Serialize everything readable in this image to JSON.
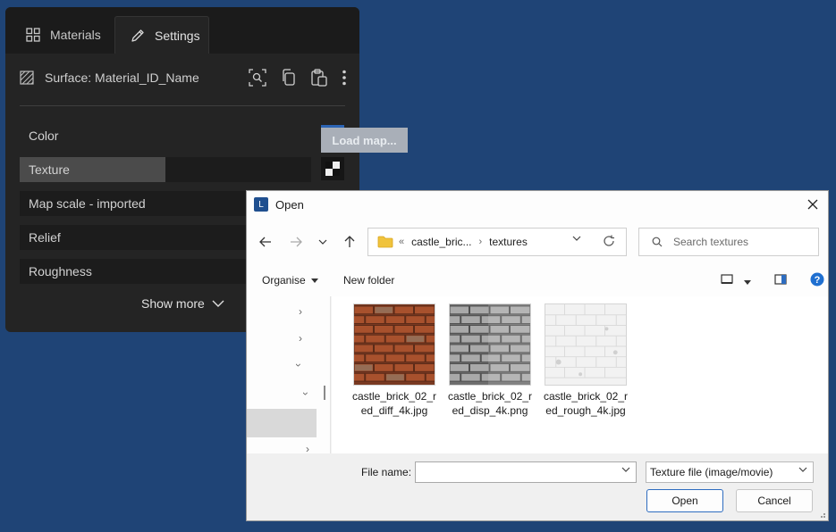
{
  "panel": {
    "tabs": [
      {
        "label": "Materials",
        "icon": "grid-icon"
      },
      {
        "label": "Settings",
        "icon": "pencil-icon"
      }
    ],
    "surface_label": "Surface: Material_ID_Name",
    "properties": [
      {
        "label": "Color"
      },
      {
        "label": "Texture"
      },
      {
        "label": "Map scale - imported"
      },
      {
        "label": "Relief"
      },
      {
        "label": "Roughness"
      }
    ],
    "texture_fill": 0.5,
    "color_swatch": "#2c64b4",
    "show_more": "Show more",
    "load_map_tooltip": "Load map..."
  },
  "dialog": {
    "title": "Open",
    "breadcrumb": [
      "castle_bric...",
      "textures"
    ],
    "search_placeholder": "Search textures",
    "organise": "Organise",
    "new_folder": "New folder",
    "files": [
      {
        "name": "castle_brick_02_red_diff_4k.jpg",
        "kind": "diffuse"
      },
      {
        "name": "castle_brick_02_red_disp_4k.png",
        "kind": "displacement"
      },
      {
        "name": "castle_brick_02_red_rough_4k.jpg",
        "kind": "roughness"
      }
    ],
    "file_name_label": "File name:",
    "file_name_value": "",
    "filter": "Texture file (image/movie)",
    "open_button": "Open",
    "cancel_button": "Cancel"
  },
  "colors": {
    "desktop": "#1f4476",
    "panel": "#242424",
    "accent": "#2d6cc0"
  }
}
